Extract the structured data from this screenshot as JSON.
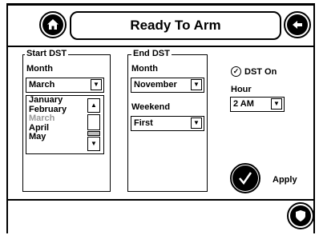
{
  "header": {
    "title": "Ready To Arm"
  },
  "start_dst": {
    "legend": "Start DST",
    "month_label": "Month",
    "selected_month": "March",
    "month_options": [
      "January",
      "February",
      "March",
      "April",
      "May"
    ]
  },
  "end_dst": {
    "legend": "End DST",
    "month_label": "Month",
    "selected_month": "November",
    "weekend_label": "Weekend",
    "selected_weekend": "First"
  },
  "dst": {
    "toggle_label": "DST On",
    "hour_label": "Hour",
    "selected_hour": "2 AM"
  },
  "actions": {
    "apply_label": "Apply"
  }
}
